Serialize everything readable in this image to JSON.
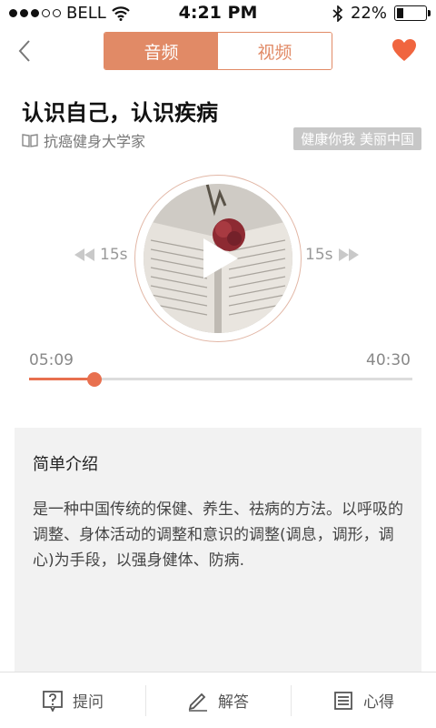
{
  "status_bar": {
    "carrier": "BELL",
    "time": "4:21 PM",
    "battery_text": "22%",
    "battery_level": 0.22,
    "signal_dots_filled": 3,
    "signal_dots_total": 5
  },
  "nav": {
    "tabs": [
      {
        "label": "音频",
        "active": true
      },
      {
        "label": "视频",
        "active": false
      }
    ],
    "icons": {
      "back": "back-chevron-icon",
      "favorite": "heart-icon"
    }
  },
  "article": {
    "title": "认识自己，认识疾病",
    "source": "抗癌健身大学家",
    "slogan": "健康你我 美丽中国"
  },
  "player": {
    "skip_back_label": "15s",
    "skip_forward_label": "15s",
    "current_time": "05:09",
    "total_time": "40:30",
    "progress": 0.1716
  },
  "intro": {
    "heading": "简单介绍",
    "body": "是一种中国传统的保健、养生、祛病的方法。以呼吸的调整、身体活动的调整和意识的调整(调息，调形，调心)为手段，以强身健体、防病."
  },
  "bottom_bar": {
    "items": [
      {
        "label": "提问",
        "icon": "question-icon"
      },
      {
        "label": "解答",
        "icon": "pencil-icon"
      },
      {
        "label": "心得",
        "icon": "notes-icon"
      }
    ]
  },
  "colors": {
    "accent": "#e18a66",
    "progress": "#e8704f",
    "heart": "#f0653f"
  }
}
